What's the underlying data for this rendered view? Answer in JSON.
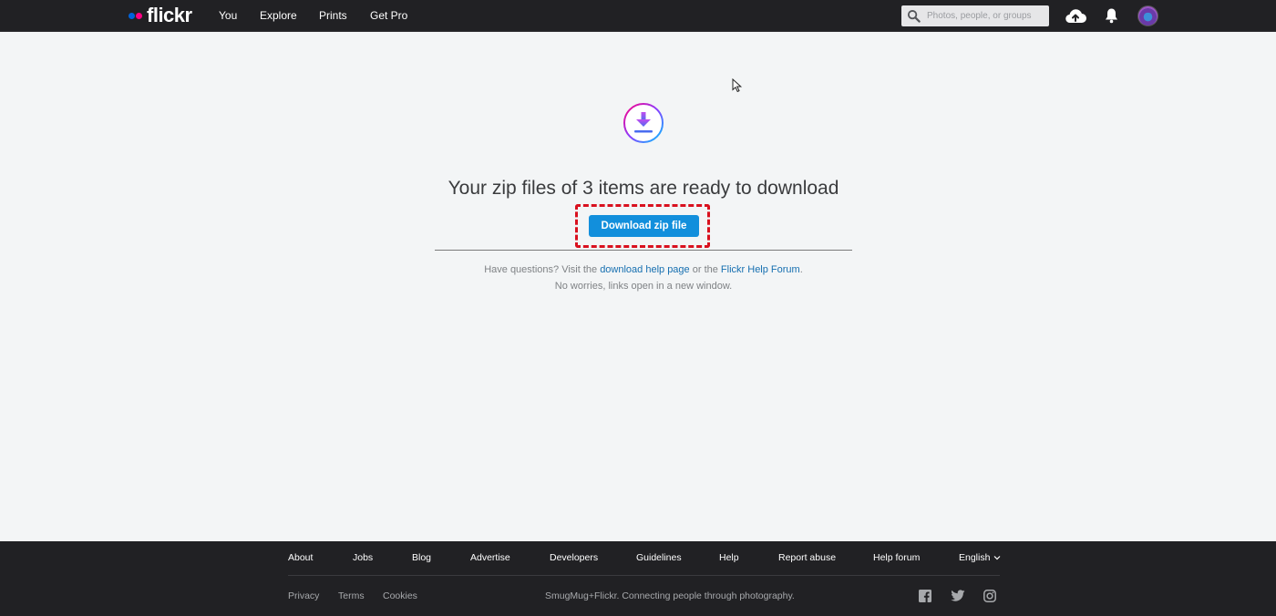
{
  "header": {
    "logo_text": "flickr",
    "nav": [
      "You",
      "Explore",
      "Prints",
      "Get Pro"
    ],
    "search_placeholder": "Photos, people, or groups",
    "icons": [
      "search-icon",
      "upload-cloud-icon",
      "notification-bell-icon",
      "avatar"
    ]
  },
  "main": {
    "headline": "Your zip files of 3 items are ready to download",
    "download_button": "Download zip file",
    "help_prefix": "Have questions? Visit the ",
    "help_link1": "download help page",
    "help_middle": " or the ",
    "help_link2": "Flickr Help Forum",
    "help_suffix": ".",
    "note": "No worries, links open in a new window."
  },
  "footer": {
    "links": [
      "About",
      "Jobs",
      "Blog",
      "Advertise",
      "Developers",
      "Guidelines",
      "Help",
      "Report abuse",
      "Help forum"
    ],
    "language": "English",
    "legal_links": [
      "Privacy",
      "Terms",
      "Cookies"
    ],
    "tagline": "SmugMug+Flickr. Connecting people through photography.",
    "social": [
      "facebook-icon",
      "twitter-icon",
      "instagram-icon"
    ]
  },
  "colors": {
    "accent": "#128fdc",
    "highlight_box": "#d9101e",
    "header_bg": "#212124",
    "page_bg": "#f3f5f6",
    "link": "#166fb0"
  }
}
